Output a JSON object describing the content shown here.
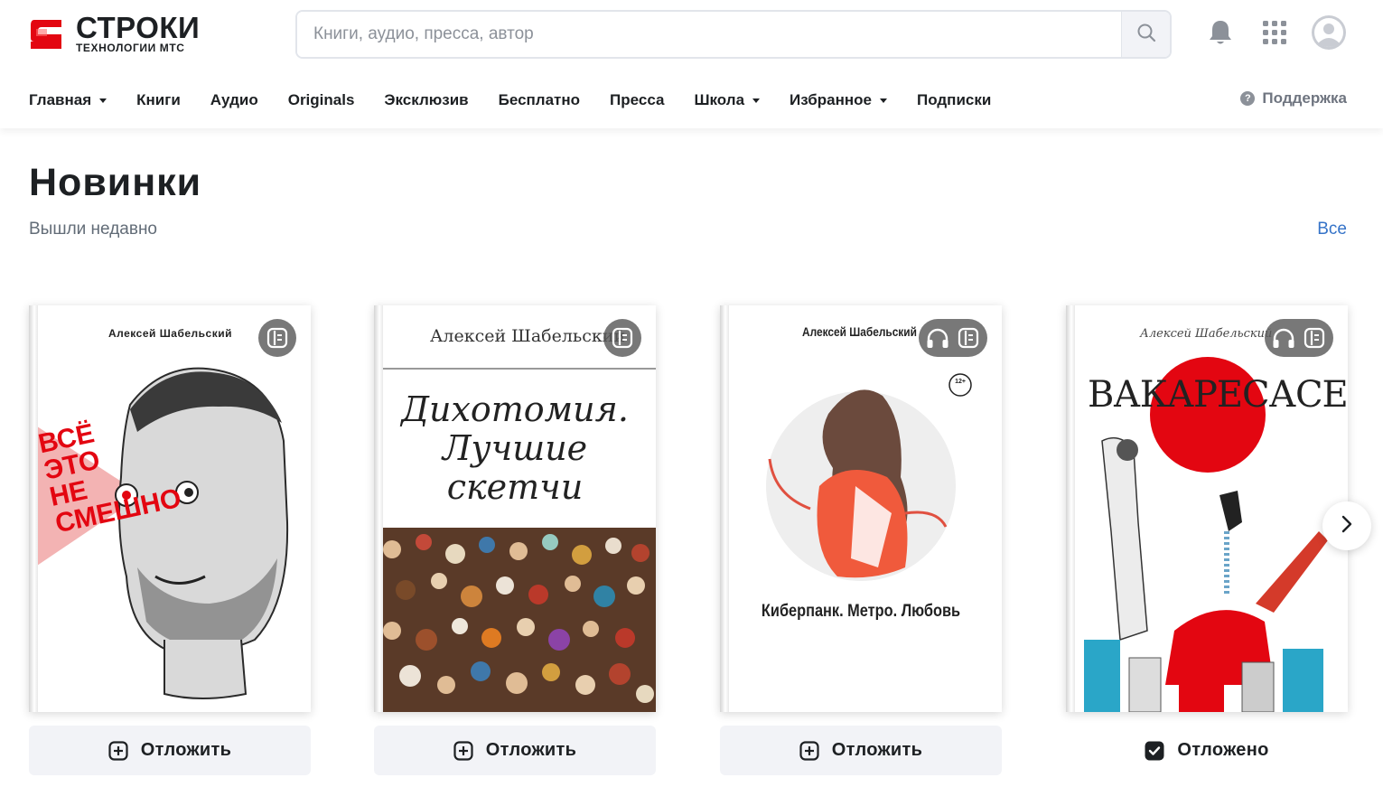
{
  "brand": {
    "name": "СТРОКИ",
    "tagline": "ТЕХНОЛОГИИ МТС",
    "accent": "#e30611"
  },
  "search": {
    "placeholder": "Книги, аудио, пресса, автор",
    "value": ""
  },
  "icons": {
    "notifications": "bell-icon",
    "apps": "grid-icon",
    "profile": "user-avatar-icon"
  },
  "nav": {
    "items": [
      {
        "label": "Главная",
        "dropdown": true
      },
      {
        "label": "Книги",
        "dropdown": false
      },
      {
        "label": "Аудио",
        "dropdown": false
      },
      {
        "label": "Originals",
        "dropdown": false
      },
      {
        "label": "Эксклюзив",
        "dropdown": false
      },
      {
        "label": "Бесплатно",
        "dropdown": false
      },
      {
        "label": "Пресса",
        "dropdown": false
      },
      {
        "label": "Школа",
        "dropdown": true
      },
      {
        "label": "Избранное",
        "dropdown": true
      },
      {
        "label": "Подписки",
        "dropdown": false
      }
    ],
    "support": "Поддержка"
  },
  "section": {
    "title": "Новинки",
    "subtitle": "Вышли недавно",
    "all_link": "Все"
  },
  "books": [
    {
      "author": "Алексей Шабельский",
      "cover_text": "ВСЁ ЭТО НЕ СМЕШНО",
      "formats": [
        "text"
      ],
      "action": "Отложить",
      "deferred": false
    },
    {
      "author": "Алексей Шабельский",
      "title_lines": [
        "Дихотомия.",
        "Лучшие",
        "скетчи"
      ],
      "formats": [
        "text"
      ],
      "action": "Отложить",
      "deferred": false
    },
    {
      "author": "Алексей Шабельский",
      "title": "Киберпанк. Метро. Любовь",
      "age": "12+",
      "formats": [
        "audio",
        "text"
      ],
      "action": "Отложить",
      "deferred": false
    },
    {
      "author": "Алексей Шабельский",
      "title": "ВАКАРЕСАСЕЯ",
      "formats": [
        "audio",
        "text"
      ],
      "action": "Отложено",
      "deferred": true
    }
  ]
}
